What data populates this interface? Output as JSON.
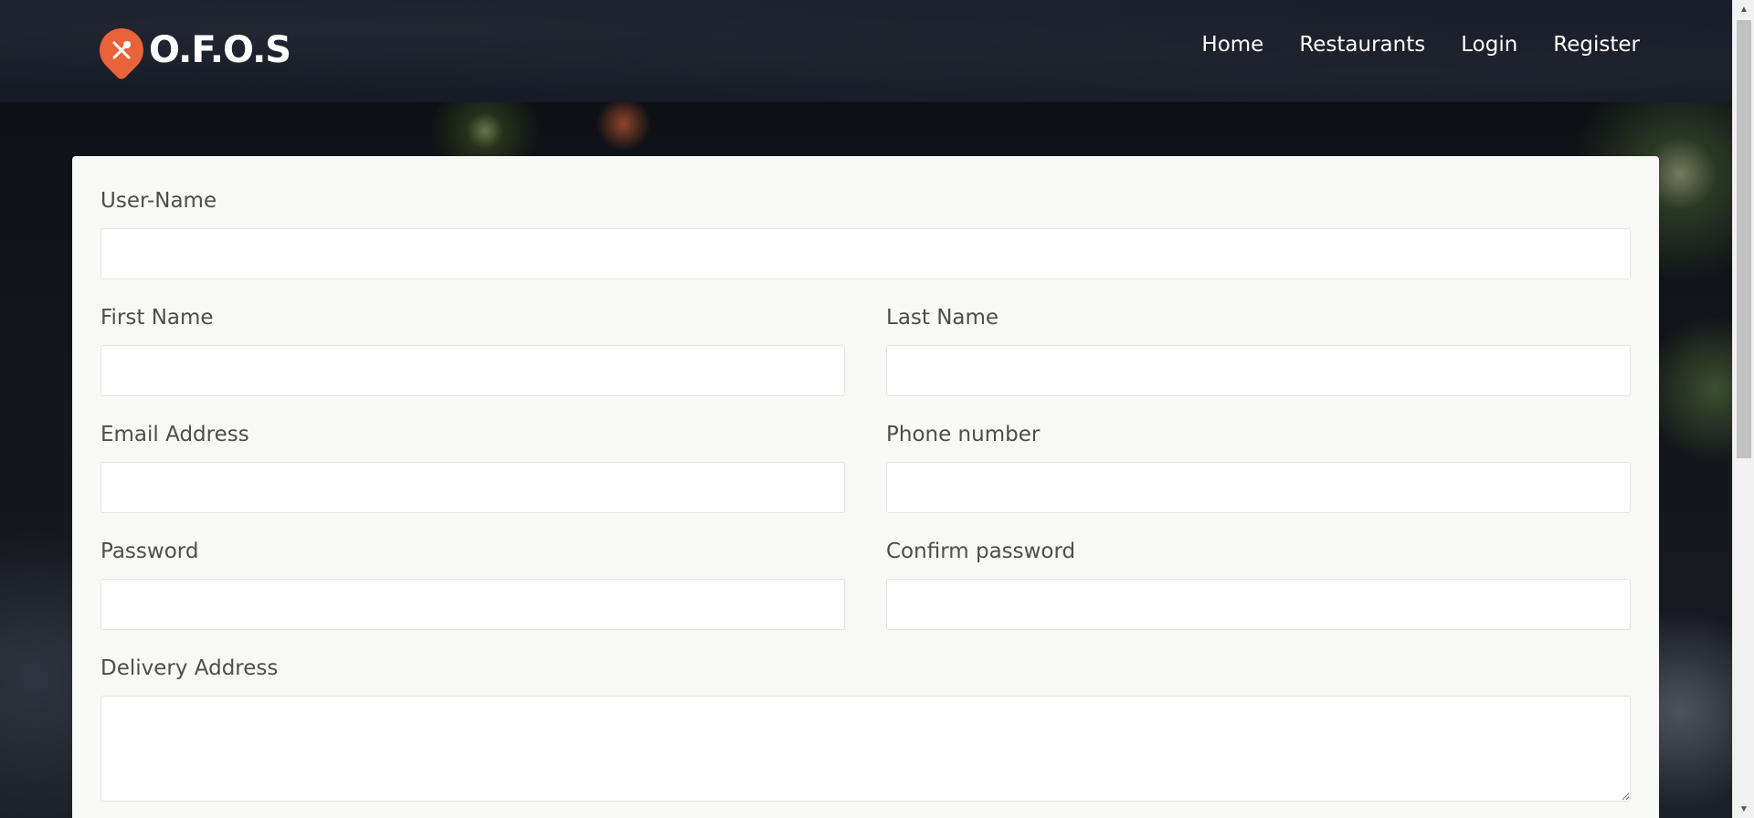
{
  "brand": {
    "name": "O.F.O.S",
    "logo_icon": "utensils-pin-icon"
  },
  "nav": {
    "items": [
      "Home",
      "Restaurants",
      "Login",
      "Register"
    ]
  },
  "form": {
    "username": {
      "label": "User-Name",
      "value": ""
    },
    "first_name": {
      "label": "First Name",
      "value": ""
    },
    "last_name": {
      "label": "Last Name",
      "value": ""
    },
    "email": {
      "label": "Email Address",
      "value": ""
    },
    "phone": {
      "label": "Phone number",
      "value": ""
    },
    "password": {
      "label": "Password",
      "value": ""
    },
    "confirm_password": {
      "label": "Confirm password",
      "value": ""
    },
    "delivery_address": {
      "label": "Delivery Address",
      "value": ""
    }
  },
  "colors": {
    "accent": "#e8623a",
    "header": "#1a1f2b",
    "card": "#f8f8f6"
  }
}
